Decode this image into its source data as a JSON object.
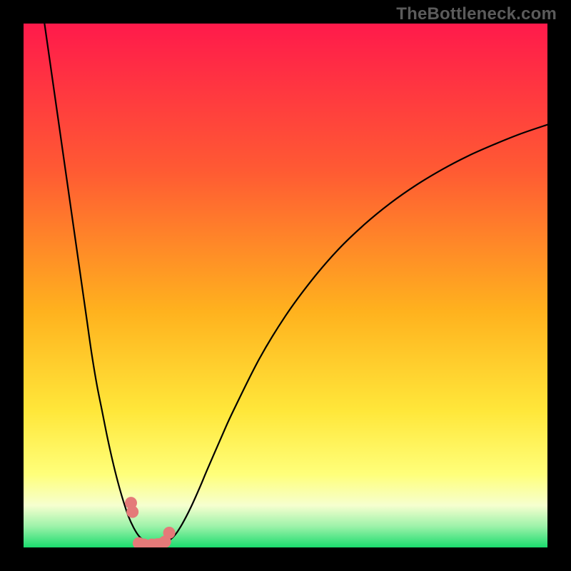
{
  "watermark": "TheBottleneck.com",
  "colors": {
    "frame_bg": "#000000",
    "gradient_top": "#ff1a4b",
    "gradient_mid1": "#ff6a2a",
    "gradient_mid2": "#ffd324",
    "gradient_low1": "#ffff66",
    "gradient_low2": "#f2ffd0",
    "gradient_bottom": "#1bdc6e",
    "curve": "#000000",
    "marker_fill": "#e47a79",
    "marker_stroke": "#cc5a5a"
  },
  "chart_data": {
    "type": "line",
    "title": "",
    "xlabel": "",
    "ylabel": "",
    "xlim": [
      0,
      100
    ],
    "ylim": [
      0,
      100
    ],
    "x": [
      4,
      5,
      6,
      7,
      8,
      9,
      10,
      11,
      12,
      13,
      14,
      15,
      16,
      17,
      18,
      19,
      20,
      21,
      22,
      23,
      24,
      25,
      26,
      27,
      28,
      29,
      30,
      31,
      32,
      33,
      34,
      35,
      38,
      40,
      45,
      50,
      55,
      60,
      65,
      70,
      75,
      80,
      85,
      90,
      95,
      100
    ],
    "y": [
      100,
      93,
      86,
      79,
      72,
      65,
      58,
      51,
      44,
      37,
      31,
      26,
      21,
      16.5,
      12.5,
      9,
      6,
      3.8,
      2.2,
      1.3,
      0.8,
      0.6,
      0.6,
      0.9,
      1.5,
      2.5,
      4,
      5.8,
      7.8,
      10,
      12.3,
      14.7,
      21.6,
      26,
      36,
      44.2,
      51,
      56.8,
      61.6,
      65.7,
      69.2,
      72.2,
      74.8,
      77,
      79,
      80.7
    ],
    "markers": {
      "x": [
        20.5,
        20.8,
        22.0,
        23.0,
        24.5,
        25.5,
        26.3,
        27.0,
        27.8
      ],
      "y": [
        8.5,
        6.8,
        0.8,
        0.55,
        0.55,
        0.6,
        0.7,
        1.1,
        2.8
      ]
    },
    "notes": "V-shaped bottleneck curve; minimum near x≈24; background gradient encodes severity (red=high, green=low)."
  }
}
